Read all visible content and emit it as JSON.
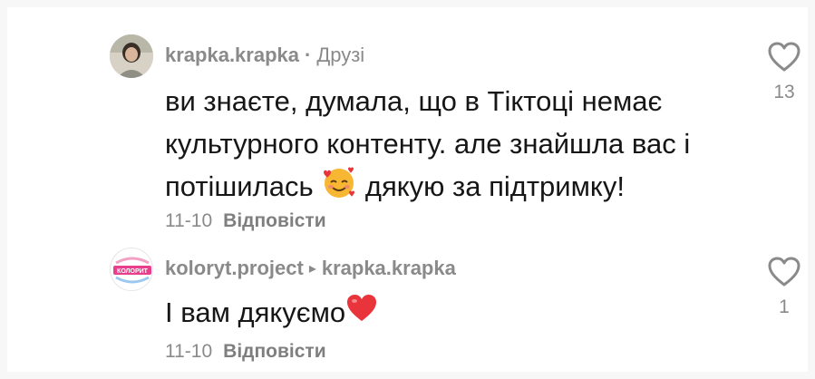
{
  "comments": [
    {
      "username": "krapka.krapka",
      "separator": "·",
      "tag": "Друзі",
      "text_line1": "ви знаєте, думала, що в Тіктоці немає",
      "text_line2": "культурного контенту. але знайшла вас і",
      "text_line3a": "потішилась",
      "text_line3b": "дякую за підтримку!",
      "emoji": "smiling-face-with-hearts-emoji",
      "date": "11-10",
      "reply_label": "Відповісти",
      "like_count": "13"
    },
    {
      "username": "koloryt.project",
      "reply_arrow": "▸",
      "reply_to": "krapka.krapka",
      "avatar_text": "КОЛОРИТ",
      "text": "І вам дякуємо",
      "emoji": "red-heart-emoji",
      "date": "11-10",
      "reply_label": "Відповісти",
      "like_count": "1"
    }
  ],
  "colors": {
    "meta_gray": "#8a8a8a",
    "text": "#161616",
    "heart_outline": "#8a8a8a",
    "emoji_heart": "#e8343a"
  }
}
